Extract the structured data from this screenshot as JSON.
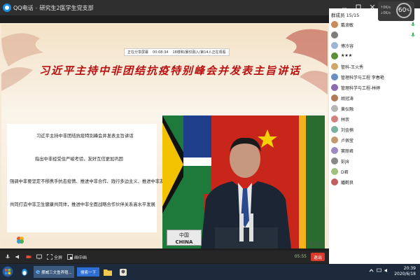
{
  "window": {
    "app_name": "QQ电话",
    "title": "研究生2医学生党支部",
    "controls": [
      "minimize-icon",
      "maximize-icon",
      "close-icon"
    ]
  },
  "speed": {
    "percent": "60",
    "unit": "%",
    "up": "0K/s",
    "down": "0K/s"
  },
  "meeting_bar": {
    "host_label": "正在分享屏幕",
    "elapsed": "00:08:34",
    "info": "18楼和/暴仅融入/第14人正在观看"
  },
  "slide": {
    "title": "习近平主持中非团结抗疫特别峰会并发表主旨讲话",
    "lines": [
      "习近平主持中非团结抗疫特别峰会并发表主旨讲话",
      "指出中非经受住严峻考验，友好互信更加巩固",
      "强调中非要坚定不移携手抗击疫情、推进中非合作、践行多边主义、推进中非友好，",
      "共同打造中非卫生健康共同体，推进中非全面战略合作伙伴关系高水平发展"
    ],
    "name_plate": {
      "cn": "中国",
      "en": "CHINA"
    },
    "caption": "新华社"
  },
  "toolbar": {
    "items": [
      {
        "icon": "mic-icon",
        "label": ""
      },
      {
        "icon": "speaker-icon",
        "label": ""
      },
      {
        "icon": "camera-off-icon",
        "label": ""
      },
      {
        "icon": "screen-share-icon",
        "label": ""
      },
      {
        "icon": "fullscreen-icon",
        "label": "全屏"
      },
      {
        "icon": "picture-in-picture-icon",
        "label": "画中画"
      }
    ],
    "time": "05:55",
    "exit": "退出"
  },
  "panel": {
    "header": "群成员 15/15",
    "members": [
      {
        "name": "戴浪敏",
        "color": "#c98a5c",
        "speaking": true
      },
      {
        "name": "",
        "color": "#7d7d7d",
        "speaking": true
      },
      {
        "name": "傅冷容",
        "color": "#9bb7d8",
        "speaking": false
      },
      {
        "name": "★★★",
        "color": "#5b8f3a",
        "speaking": false
      },
      {
        "name": "管科-王火秀",
        "color": "#d0a76a",
        "speaking": false
      },
      {
        "name": "管理科学与工程 李春艳",
        "color": "#6a8fc4",
        "speaking": false
      },
      {
        "name": "管理科学与工程-林婷",
        "color": "#8c6bb0",
        "speaking": false
      },
      {
        "name": "胡冠涛",
        "color": "#b07b5a",
        "speaking": false
      },
      {
        "name": "黄仪融",
        "color": "#b5b5b5",
        "speaking": false
      },
      {
        "name": "林崇",
        "color": "#d28080",
        "speaking": false
      },
      {
        "name": "刘金楠",
        "color": "#7ab0a0",
        "speaking": false
      },
      {
        "name": "卢佩莹",
        "color": "#c49a6c",
        "speaking": false
      },
      {
        "name": "窦丽君",
        "color": "#9c8ac0",
        "speaking": false
      },
      {
        "name": "彭J8",
        "color": "#888888",
        "speaking": false
      },
      {
        "name": "D君",
        "color": "#a0c080",
        "speaking": false
      },
      {
        "name": "蟠鹤良",
        "color": "#c06060",
        "speaking": false
      }
    ]
  },
  "taskbar": {
    "apps": [
      {
        "icon": "start-icon"
      },
      {
        "icon": "qq-icon"
      },
      {
        "icon": "ie-icon",
        "label": "挪威三文鱼养殖..."
      },
      {
        "icon": "search-icon",
        "label": "搜索一下"
      },
      {
        "icon": "folder-icon"
      },
      {
        "icon": "qq-chat-icon"
      }
    ],
    "time": "20:39",
    "date": "2020/6/18"
  }
}
